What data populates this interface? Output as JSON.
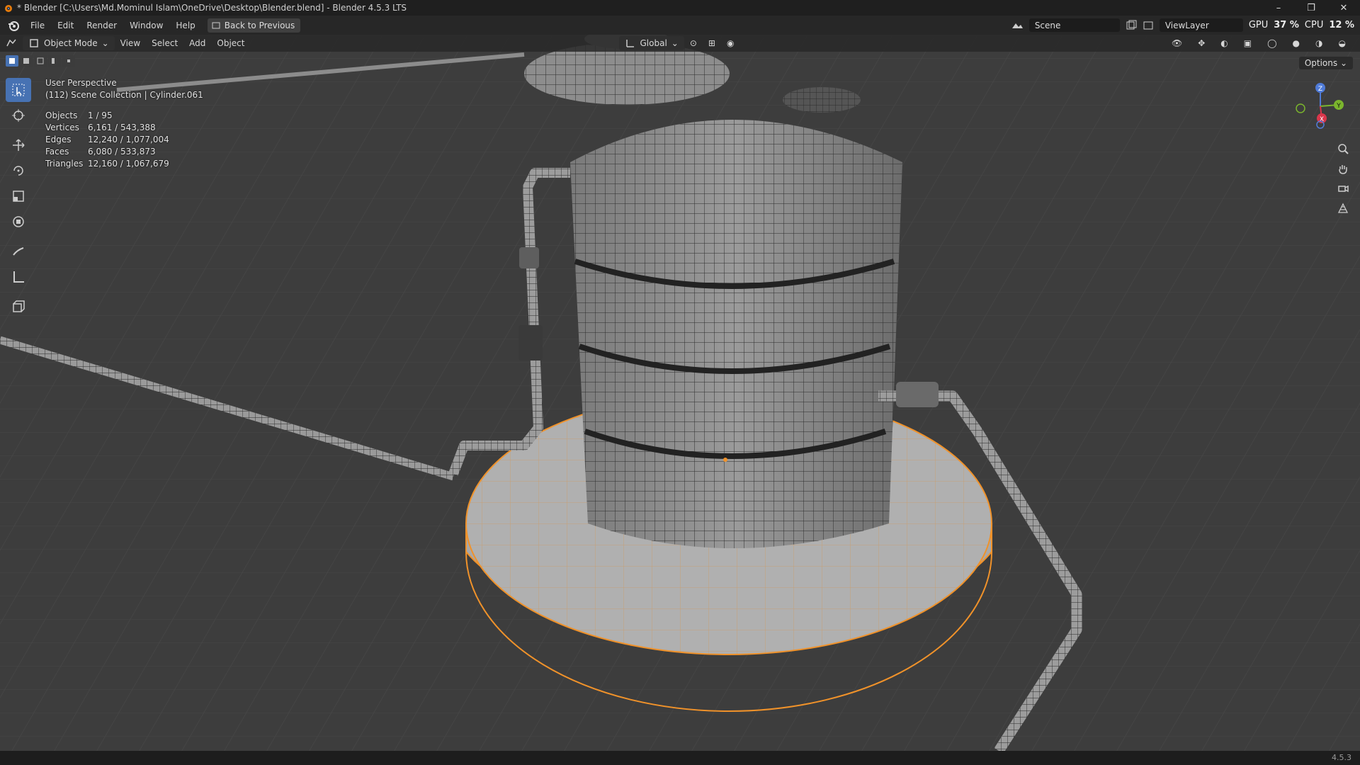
{
  "titlebar": {
    "title": "* Blender [C:\\Users\\Md.Mominul Islam\\OneDrive\\Desktop\\Blender.blend] - Blender 4.5.3 LTS",
    "minimize": "–",
    "maximize": "❐",
    "close": "✕"
  },
  "menu": {
    "items": [
      "File",
      "Edit",
      "Render",
      "Window",
      "Help"
    ],
    "back_button": "Back to Previous",
    "scene": "Scene",
    "view_layer": "ViewLayer",
    "gpu_label": "GPU",
    "gpu_value": "37 %",
    "cpu_label": "CPU",
    "cpu_value": "12 %"
  },
  "header": {
    "mode": "Object Mode",
    "menus": [
      "View",
      "Select",
      "Add",
      "Object"
    ],
    "orientation": "Global"
  },
  "options_label": "Options",
  "overlay": {
    "perspective": "User Perspective",
    "collection": "(112) Scene Collection | Cylinder.061",
    "stats": [
      {
        "label": "Objects",
        "value": "1 / 95"
      },
      {
        "label": "Vertices",
        "value": "6,161 / 543,388"
      },
      {
        "label": "Edges",
        "value": "12,240 / 1,077,004"
      },
      {
        "label": "Faces",
        "value": "6,080 / 533,873"
      },
      {
        "label": "Triangles",
        "value": "12,160 / 1,067,679"
      }
    ]
  },
  "gizmo": {
    "z": "Z",
    "y": "Y",
    "x": "X"
  },
  "colors": {
    "accent": "#4772b3",
    "selection": "#f0922a",
    "grid": "#4a4a4a"
  },
  "status": {
    "version": "4.5.3"
  }
}
